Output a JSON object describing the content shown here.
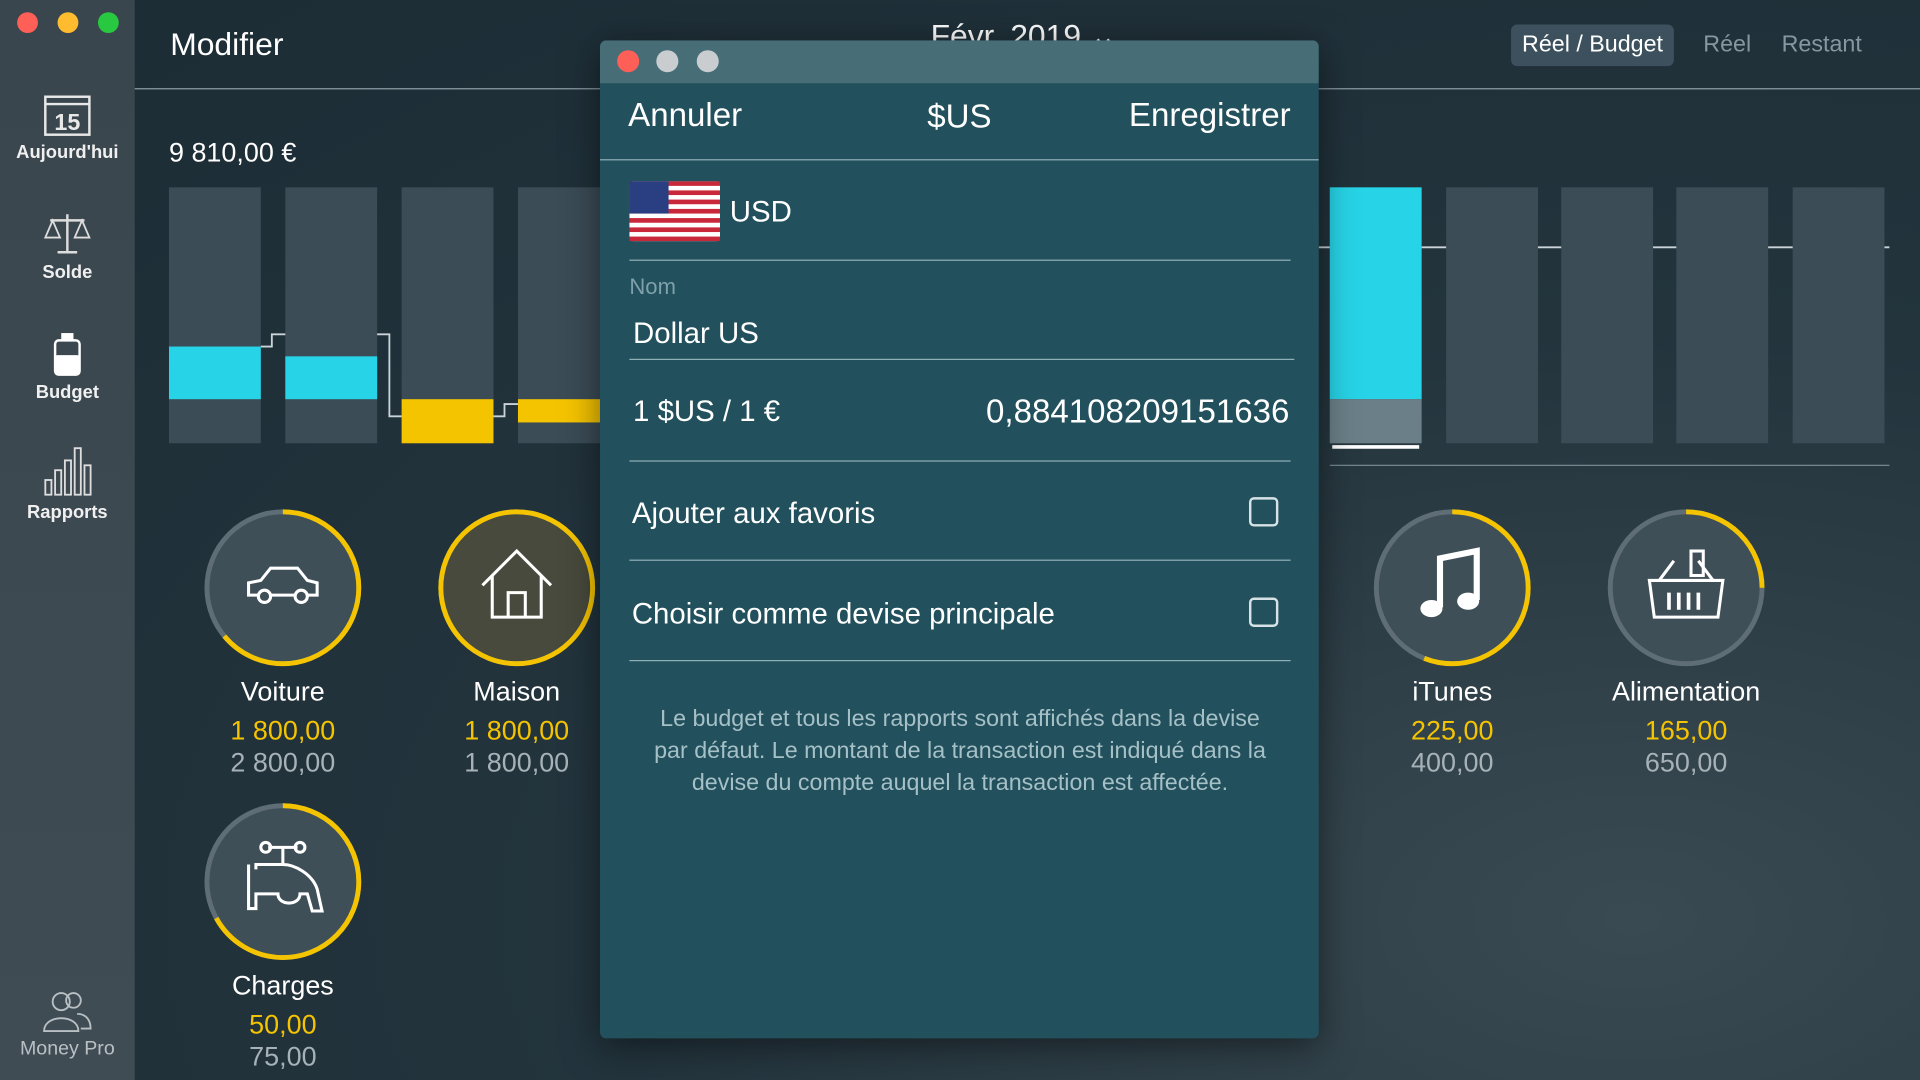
{
  "window": {
    "traffic_lights": [
      "#fe5f57",
      "#febc2e",
      "#28c840"
    ]
  },
  "sidebar": {
    "items": [
      {
        "label": "Aujourd'hui",
        "icon": "calendar-icon",
        "day": "15"
      },
      {
        "label": "Solde",
        "icon": "scale-icon"
      },
      {
        "label": "Budget",
        "icon": "jar-icon"
      },
      {
        "label": "Rapports",
        "icon": "bar-chart-icon"
      }
    ],
    "footer_label": "Money Pro"
  },
  "header": {
    "edit_label": "Modifier",
    "period": "Févr. 2019",
    "period_chevron": "⌄",
    "segments": [
      {
        "label": "Réel / Budget",
        "active": true
      },
      {
        "label": "Réel",
        "active": false
      },
      {
        "label": "Restant",
        "active": false
      }
    ]
  },
  "budget": {
    "total": "9 810,00 €",
    "bars": [
      {
        "fill": 0.21,
        "color": "#27d3e6",
        "base": 0.17
      },
      {
        "fill": 0.17,
        "color": "#27d3e6",
        "base": 0.17
      },
      {
        "fill": 0.17,
        "color": "#f5c400",
        "base": 0
      },
      {
        "fill": 0.09,
        "color": "#f5c400",
        "base": 0.08
      },
      {
        "fill": 0.83,
        "color": "#27d3e6",
        "base": 0.17,
        "selected": true
      },
      {
        "fill": 0,
        "color": "#27d3e6",
        "base": 0
      },
      {
        "fill": 0,
        "color": "#27d3e6",
        "base": 0
      },
      {
        "fill": 0,
        "color": "#27d3e6",
        "base": 0
      },
      {
        "fill": 0,
        "color": "#27d3e6",
        "base": 0
      }
    ]
  },
  "categories": [
    {
      "name": "Voiture",
      "actual": "1 800,00",
      "budget": "2 800,00",
      "icon": "car-icon",
      "progress": 0.64
    },
    {
      "name": "Maison",
      "actual": "1 800,00",
      "budget": "1 800,00",
      "icon": "house-icon",
      "progress": 1.0
    },
    {
      "name": "iTunes",
      "actual": "225,00",
      "budget": "400,00",
      "icon": "music-note-icon",
      "progress": 0.56
    },
    {
      "name": "Alimentation",
      "actual": "165,00",
      "budget": "650,00",
      "icon": "shopping-basket-icon",
      "progress": 0.25
    },
    {
      "name": "Charges",
      "actual": "50,00",
      "budget": "75,00",
      "icon": "faucet-icon",
      "progress": 0.67
    }
  ],
  "modal": {
    "cancel_label": "Annuler",
    "title": "$US",
    "save_label": "Enregistrer",
    "currency_code": "USD",
    "flag": "us-flag-icon",
    "name_label": "Nom",
    "name_value": "Dollar US",
    "rate_label": "1 $US / 1 €",
    "rate_value": "0,884108209151636",
    "favorites_label": "Ajouter aux favoris",
    "favorites_checked": false,
    "main_currency_label": "Choisir comme devise principale",
    "main_currency_checked": false,
    "info_text": "Le budget et tous les rapports sont affichés dans la devise par défaut. Le montant de la transaction est indiqué dans la devise du compte auquel la transaction est affectée."
  },
  "colors": {
    "actual": "#f5c400",
    "accent": "#27d3e6",
    "modal_bg": "#22505c"
  }
}
